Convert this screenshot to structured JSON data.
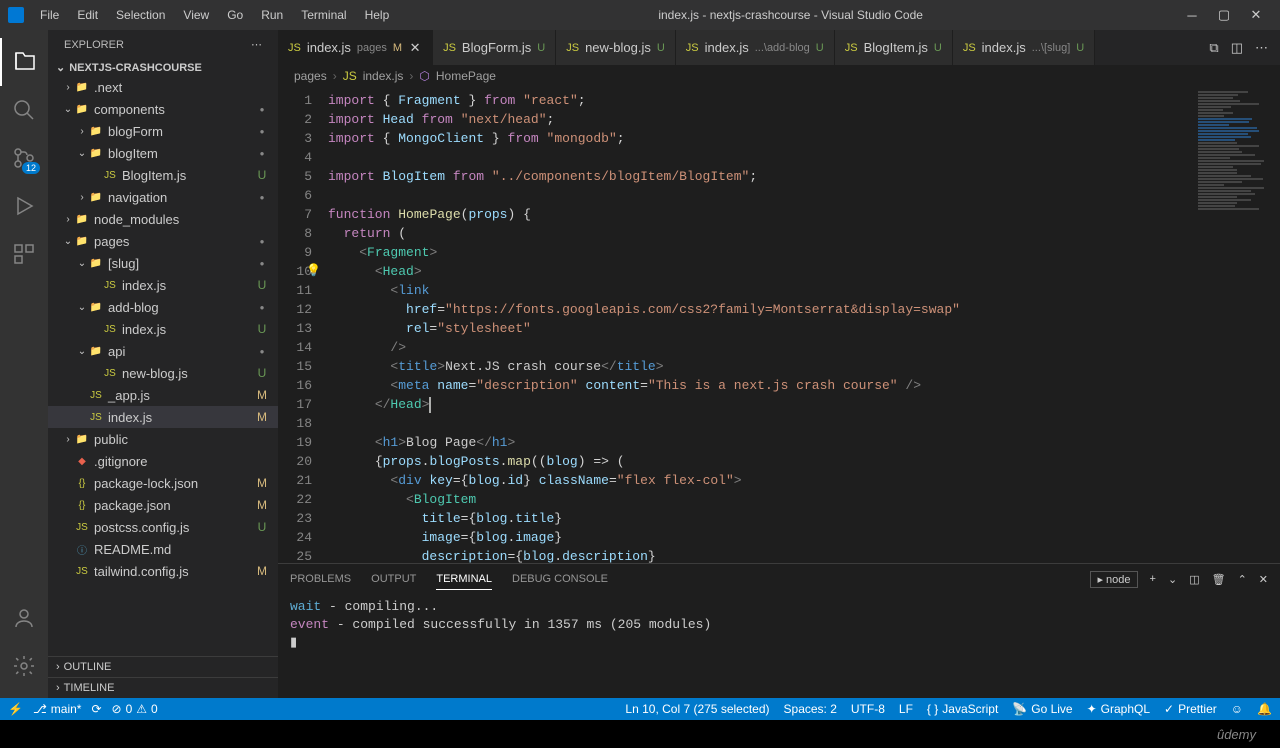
{
  "window": {
    "title": "index.js - nextjs-crashcourse - Visual Studio Code"
  },
  "menu": [
    "File",
    "Edit",
    "Selection",
    "View",
    "Go",
    "Run",
    "Terminal",
    "Help"
  ],
  "activity": {
    "scm_badge": "12"
  },
  "sidebar": {
    "title": "EXPLORER",
    "project": "NEXTJS-CRASHCOURSE",
    "outline": "OUTLINE",
    "timeline": "TIMELINE",
    "tree": [
      {
        "label": ".next",
        "type": "folder",
        "depth": 1,
        "expanded": false
      },
      {
        "label": "components",
        "type": "folder",
        "depth": 1,
        "expanded": true,
        "dot": true
      },
      {
        "label": "blogForm",
        "type": "folder",
        "depth": 2,
        "expanded": false,
        "dot": true
      },
      {
        "label": "blogItem",
        "type": "folder",
        "depth": 2,
        "expanded": true,
        "dot": true
      },
      {
        "label": "BlogItem.js",
        "type": "js",
        "depth": 3,
        "status": "U"
      },
      {
        "label": "navigation",
        "type": "folder",
        "depth": 2,
        "expanded": false,
        "dot": true
      },
      {
        "label": "node_modules",
        "type": "folder",
        "depth": 1,
        "expanded": false
      },
      {
        "label": "pages",
        "type": "folder",
        "depth": 1,
        "expanded": true,
        "dot": true
      },
      {
        "label": "[slug]",
        "type": "folder",
        "depth": 2,
        "expanded": true,
        "dot": true
      },
      {
        "label": "index.js",
        "type": "js",
        "depth": 3,
        "status": "U"
      },
      {
        "label": "add-blog",
        "type": "folder",
        "depth": 2,
        "expanded": true,
        "dot": true
      },
      {
        "label": "index.js",
        "type": "js",
        "depth": 3,
        "status": "U"
      },
      {
        "label": "api",
        "type": "folder",
        "depth": 2,
        "expanded": true,
        "dot": true
      },
      {
        "label": "new-blog.js",
        "type": "js",
        "depth": 3,
        "status": "U"
      },
      {
        "label": "_app.js",
        "type": "js",
        "depth": 2,
        "status": "M"
      },
      {
        "label": "index.js",
        "type": "js",
        "depth": 2,
        "status": "M",
        "active": true
      },
      {
        "label": "public",
        "type": "folder",
        "depth": 1,
        "expanded": false
      },
      {
        "label": ".gitignore",
        "type": "git",
        "depth": 1
      },
      {
        "label": "package-lock.json",
        "type": "json",
        "depth": 1,
        "status": "M"
      },
      {
        "label": "package.json",
        "type": "json",
        "depth": 1,
        "status": "M"
      },
      {
        "label": "postcss.config.js",
        "type": "js",
        "depth": 1,
        "status": "U"
      },
      {
        "label": "README.md",
        "type": "info",
        "depth": 1
      },
      {
        "label": "tailwind.config.js",
        "type": "js",
        "depth": 1,
        "status": "M"
      }
    ]
  },
  "tabs": [
    {
      "label": "index.js",
      "detail": "pages",
      "status": "M",
      "active": true,
      "close": true
    },
    {
      "label": "BlogForm.js",
      "status": "U"
    },
    {
      "label": "new-blog.js",
      "status": "U"
    },
    {
      "label": "index.js",
      "detail": "...\\add-blog",
      "status": "U"
    },
    {
      "label": "BlogItem.js",
      "status": "U"
    },
    {
      "label": "index.js",
      "detail": "...\\[slug]",
      "status": "U"
    }
  ],
  "breadcrumbs": [
    "pages",
    "index.js",
    "HomePage"
  ],
  "code": {
    "lines": [
      {
        "n": 1,
        "html": "<span class='kw'>import</span> <span class='pun'>{</span> <span class='var'>Fragment</span> <span class='pun'>}</span> <span class='kw'>from</span> <span class='str'>\"react\"</span><span class='pun'>;</span>"
      },
      {
        "n": 2,
        "html": "<span class='kw'>import</span> <span class='var'>Head</span> <span class='kw'>from</span> <span class='str'>\"next/head\"</span><span class='pun'>;</span>"
      },
      {
        "n": 3,
        "html": "<span class='kw'>import</span> <span class='pun'>{</span> <span class='var'>MongoClient</span> <span class='pun'>}</span> <span class='kw'>from</span> <span class='str'>\"mongodb\"</span><span class='pun'>;</span>"
      },
      {
        "n": 4,
        "html": ""
      },
      {
        "n": 5,
        "html": "<span class='kw'>import</span> <span class='var'>BlogItem</span> <span class='kw'>from</span> <span class='str'>\"../components/blogItem/BlogItem\"</span><span class='pun'>;</span>"
      },
      {
        "n": 6,
        "html": ""
      },
      {
        "n": 7,
        "html": "<span class='kw'>function</span> <span class='fn'>HomePage</span><span class='pun'>(</span><span class='var'>props</span><span class='pun'>) {</span>"
      },
      {
        "n": 8,
        "html": "  <span class='kw'>return</span> <span class='pun'>(</span>"
      },
      {
        "n": 9,
        "html": "    <span class='tag'>&lt;</span><span class='cls'>Fragment</span><span class='tag'>&gt;</span>"
      },
      {
        "n": 10,
        "hl": true,
        "bulb": true,
        "html": "      <span class='tag'>&lt;</span><span class='cls'>Head</span><span class='tag'>&gt;</span>"
      },
      {
        "n": 11,
        "hl": true,
        "html": "        <span class='tag'>&lt;</span><span class='tagname'>link</span>"
      },
      {
        "n": 12,
        "hl": true,
        "html": "          <span class='attr'>href</span><span class='pun'>=</span><span class='str'>\"https://fonts.googleapis.com/css2?family=Montserrat&amp;display=swap\"</span>"
      },
      {
        "n": 13,
        "hl": true,
        "html": "          <span class='attr'>rel</span><span class='pun'>=</span><span class='str'>\"stylesheet\"</span>"
      },
      {
        "n": 14,
        "hl": true,
        "html": "        <span class='tag'>/&gt;</span>"
      },
      {
        "n": 15,
        "hl": true,
        "html": "        <span class='tag'>&lt;</span><span class='tagname'>title</span><span class='tag'>&gt;</span>Next.JS crash course<span class='tag'>&lt;/</span><span class='tagname'>title</span><span class='tag'>&gt;</span>"
      },
      {
        "n": 16,
        "hl": true,
        "html": "        <span class='tag'>&lt;</span><span class='tagname'>meta</span> <span class='attr'>name</span><span class='pun'>=</span><span class='str'>\"description\"</span> <span class='attr'>content</span><span class='pun'>=</span><span class='str'>\"This is a next.js crash course\"</span> <span class='tag'>/&gt;</span>"
      },
      {
        "n": 17,
        "hl": true,
        "cursor": true,
        "html": "      <span class='tag'>&lt;/</span><span class='cls'>Head</span><span class='tag'>&gt;</span>"
      },
      {
        "n": 18,
        "html": ""
      },
      {
        "n": 19,
        "html": "      <span class='tag'>&lt;</span><span class='tagname'>h1</span><span class='tag'>&gt;</span>Blog Page<span class='tag'>&lt;/</span><span class='tagname'>h1</span><span class='tag'>&gt;</span>"
      },
      {
        "n": 20,
        "html": "      <span class='pun'>{</span><span class='var'>props</span><span class='pun'>.</span><span class='var'>blogPosts</span><span class='pun'>.</span><span class='fn'>map</span><span class='pun'>((</span><span class='var'>blog</span><span class='pun'>) =&gt; (</span>"
      },
      {
        "n": 21,
        "html": "        <span class='tag'>&lt;</span><span class='tagname'>div</span> <span class='attr'>key</span><span class='pun'>={</span><span class='var'>blog</span><span class='pun'>.</span><span class='var'>id</span><span class='pun'>}</span> <span class='attr'>className</span><span class='pun'>=</span><span class='str'>\"flex flex-col\"</span><span class='tag'>&gt;</span>"
      },
      {
        "n": 22,
        "html": "          <span class='tag'>&lt;</span><span class='cls'>BlogItem</span>"
      },
      {
        "n": 23,
        "html": "            <span class='attr'>title</span><span class='pun'>={</span><span class='var'>blog</span><span class='pun'>.</span><span class='var'>title</span><span class='pun'>}</span>"
      },
      {
        "n": 24,
        "html": "            <span class='attr'>image</span><span class='pun'>={</span><span class='var'>blog</span><span class='pun'>.</span><span class='var'>image</span><span class='pun'>}</span>"
      },
      {
        "n": 25,
        "html": "            <span class='attr'>description</span><span class='pun'>={</span><span class='var'>blog</span><span class='pun'>.</span><span class='var'>description</span><span class='pun'>}</span>"
      }
    ]
  },
  "panel": {
    "tabs": [
      "PROBLEMS",
      "OUTPUT",
      "TERMINAL",
      "DEBUG CONSOLE"
    ],
    "active": "TERMINAL",
    "shell": "node",
    "lines": [
      {
        "prefix": "wait",
        "cls": "term-wait",
        "text": "  - compiling..."
      },
      {
        "prefix": "event",
        "cls": "term-event",
        "text": " - compiled successfully in 1357 ms (205 modules)"
      }
    ]
  },
  "status": {
    "branch": "main*",
    "sync": "⟳",
    "errors": "0",
    "warnings": "0",
    "cursor": "Ln 10, Col 7 (275 selected)",
    "spaces": "Spaces: 2",
    "encoding": "UTF-8",
    "eol": "LF",
    "lang": "JavaScript",
    "golive": "Go Live",
    "graphql": "GraphQL",
    "prettier": "Prettier"
  },
  "footer": "ûdemy"
}
